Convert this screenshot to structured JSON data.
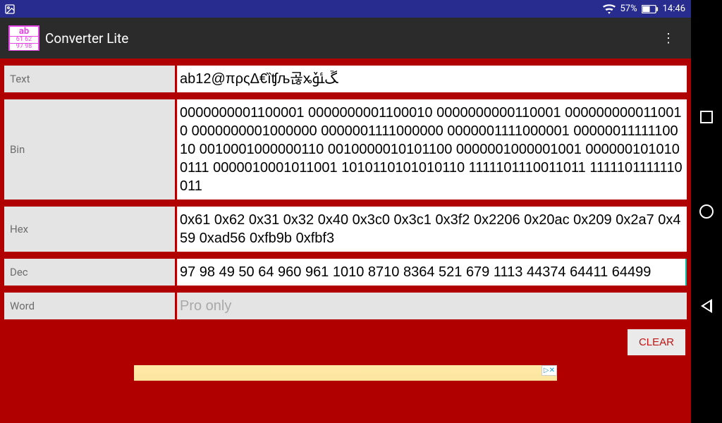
{
  "statusbar": {
    "battery_pct": "57%",
    "time": "14:46"
  },
  "appbar": {
    "title": "Converter Lite"
  },
  "fields": {
    "text": {
      "label": "Text",
      "value": "ab12@πρςΔ€ȉʧљ곦ꭖﮛﯳ"
    },
    "bin": {
      "label": "Bin",
      "value": "0000000001100001 0000000001100010 0000000000110001 0000000000110010 0000000001000000 0000001111000000 0000001111000001 0000001111110010 0010001000000110 0010000010101100 0000001000001001 0000001010100111 0000010001011001 1010110101010110 1111101110011011 1111101111110011"
    },
    "hex": {
      "label": "Hex",
      "value": "0x61 0x62 0x31 0x32 0x40 0x3c0 0x3c1 0x3f2 0x2206 0x20ac 0x209 0x2a7 0x459 0xad56 0xfb9b 0xfbf3"
    },
    "dec": {
      "label": "Dec",
      "value": "97 98 49 50 64 960 961 1010 8710 8364 521 679 1113 44374 64411 64499"
    },
    "word": {
      "label": "Word",
      "placeholder": "Pro only"
    }
  },
  "buttons": {
    "clear": "CLEAR"
  },
  "ad": {
    "badge": "▷✕"
  }
}
